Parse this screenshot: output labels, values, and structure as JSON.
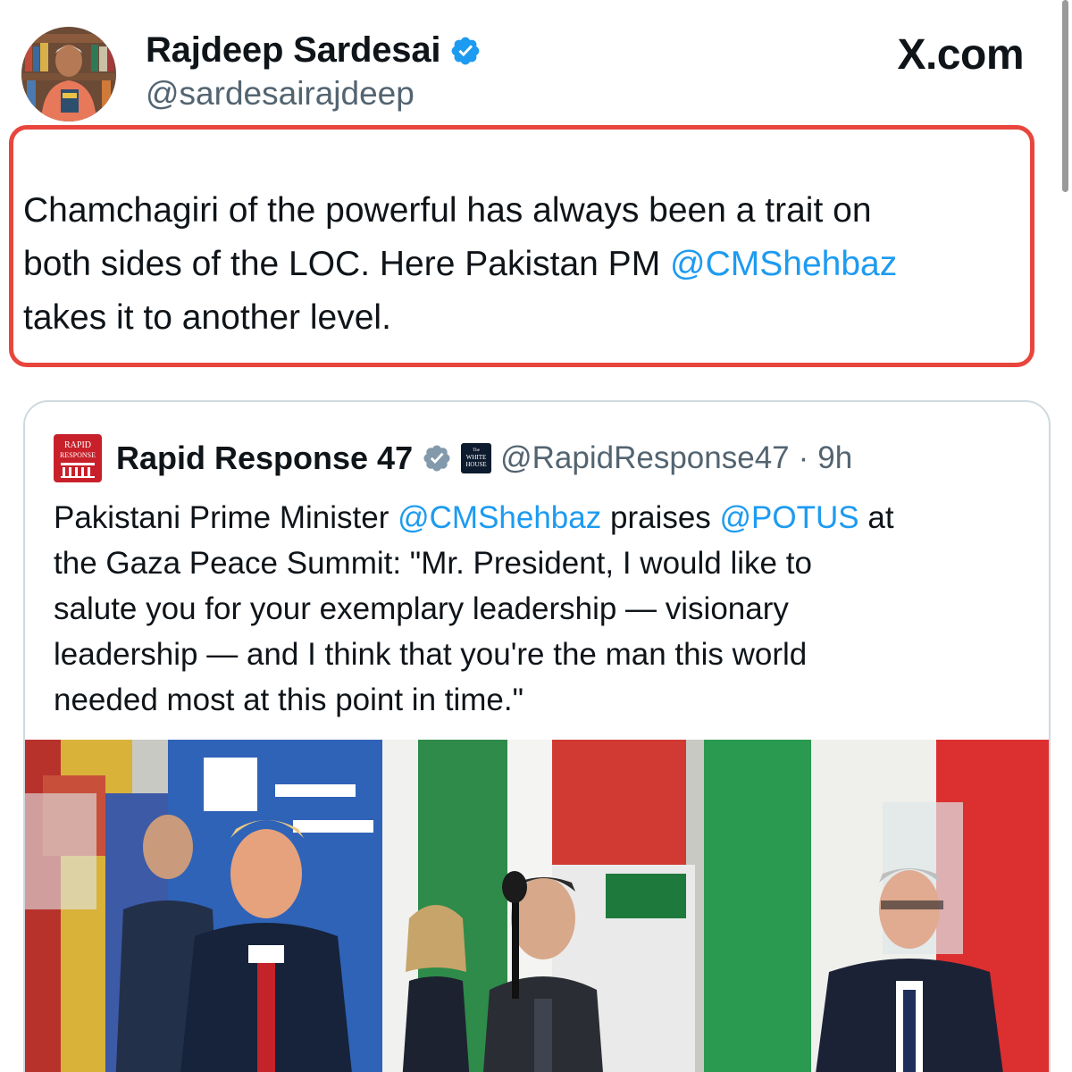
{
  "author": {
    "name": "Rajdeep Sardesai",
    "handle": "@sardesairajdeep",
    "avatar_icon": "avatar-photo",
    "verified_icon": "verified-badge-icon"
  },
  "brand": "X.com",
  "tweet": {
    "lines": [
      "Chamchagiri of the powerful has always been a trait on",
      "both sides of the LOC. Here Pakistan PM ",
      "takes it to another level."
    ],
    "mention": "@CMShehbaz",
    "highlight_color": "#e8463d"
  },
  "quoted": {
    "logo_text_top": "RAPID",
    "logo_text_bottom": "RESPONSE",
    "name": "Rapid Response 47",
    "badge_text_top": "The",
    "badge_text_mid": "WHITE",
    "badge_text_bottom": "HOUSE",
    "handle": "@RapidResponse47",
    "separator": "·",
    "time": "9h",
    "text": {
      "l1_a": "Pakistani Prime Minister ",
      "l1_m1": "@CMShehbaz",
      "l1_b": " praises ",
      "l1_m2": "@POTUS",
      "l1_c": " at",
      "l2": "the Gaza Peace Summit: \"Mr. President, I would like to",
      "l3": "salute you for your exemplary leadership — visionary",
      "l4": "leadership — and I think that you're the man this world",
      "l5": "needed most at this point in time.\""
    }
  },
  "colors": {
    "link": "#1d9bf0",
    "text": "#0f1419",
    "secondary": "#536471",
    "verified": "#1d9bf0",
    "card_border": "#cfd9de"
  }
}
